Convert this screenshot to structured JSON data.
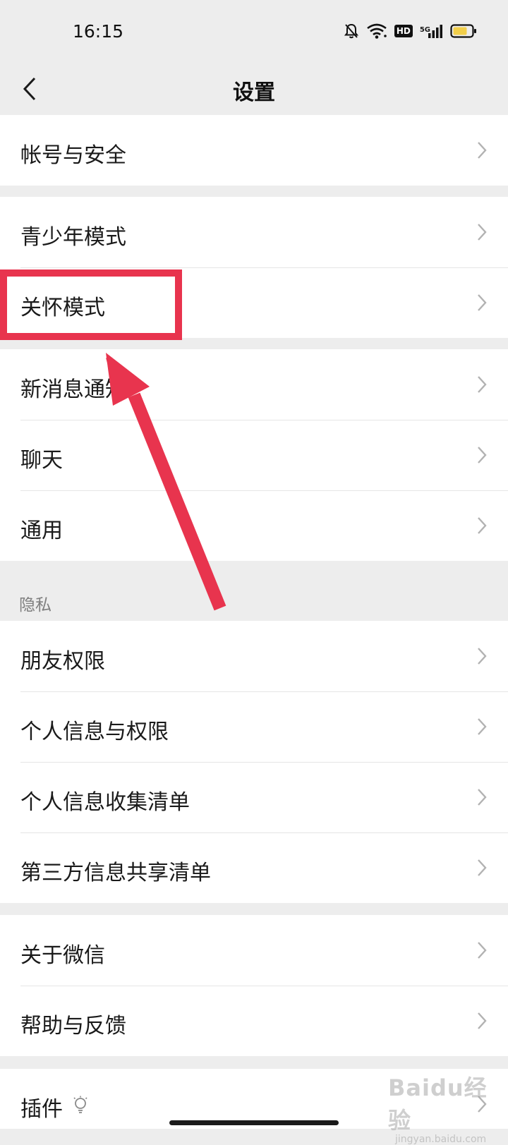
{
  "status_bar": {
    "time": "16:15",
    "icons": [
      "bell-muted-icon",
      "wifi-icon",
      "hd-icon",
      "signal-5g-icon",
      "battery-icon"
    ],
    "hd_label": "HD",
    "network_label": "5G",
    "battery_color": "#f2cf4a"
  },
  "nav": {
    "title": "设置",
    "back_icon": "chevron-left-icon"
  },
  "groups": {
    "account": [
      "帐号与安全"
    ],
    "modes": [
      "青少年模式",
      "关怀模式"
    ],
    "general": [
      "新消息通知",
      "聊天",
      "通用"
    ],
    "privacy_header": "隐私",
    "privacy": [
      "朋友权限",
      "个人信息与权限",
      "个人信息收集清单",
      "第三方信息共享清单"
    ],
    "about": [
      "关于微信",
      "帮助与反馈"
    ],
    "plugins": [
      "插件"
    ]
  },
  "annotation": {
    "highlight_color": "#e8344e",
    "highlighted_item": "关怀模式"
  },
  "watermark": {
    "logo": "Baidu经验",
    "sub": "jingyan.baidu.com"
  },
  "colors": {
    "background": "#ededed",
    "row_background": "#ffffff",
    "text": "#1a1a1a",
    "chevron": "#b2b2b2"
  }
}
